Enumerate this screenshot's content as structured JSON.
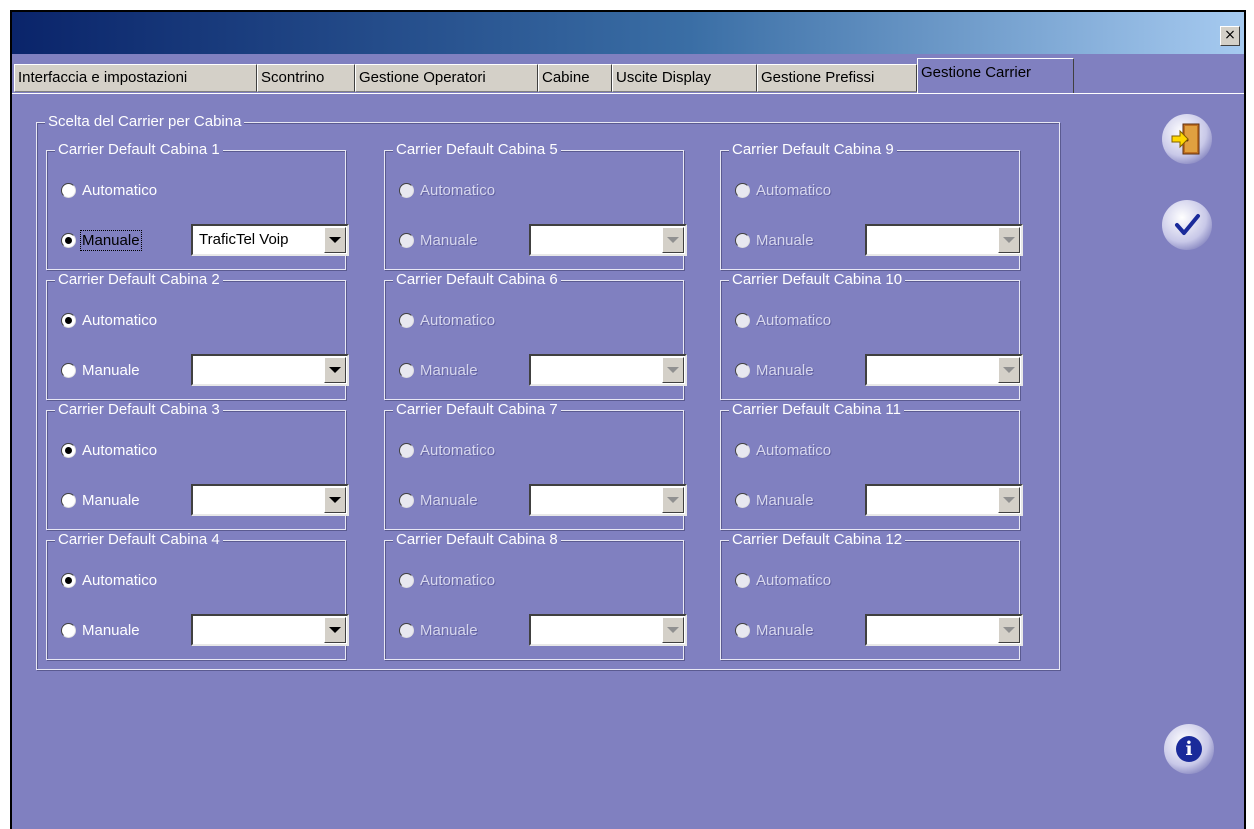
{
  "window": {
    "close_label": "×"
  },
  "tabs": [
    {
      "label": "Interfaccia  e impostazioni"
    },
    {
      "label": "Scontrino"
    },
    {
      "label": "Gestione Operatori"
    },
    {
      "label": "Cabine"
    },
    {
      "label": "Uscite Display"
    },
    {
      "label": "Gestione Prefissi"
    },
    {
      "label": "Gestione Carrier"
    }
  ],
  "active_tab": "Gestione Carrier",
  "main_group": {
    "title": "Scelta del Carrier per Cabina"
  },
  "option_labels": {
    "auto": "Automatico",
    "manual": "Manuale"
  },
  "cabins": [
    {
      "title": "Carrier Default Cabina 1",
      "selected": "manual",
      "carrier": "TraficTel Voip",
      "enabled": true
    },
    {
      "title": "Carrier Default Cabina 2",
      "selected": "auto",
      "carrier": "",
      "enabled": true
    },
    {
      "title": "Carrier Default Cabina 3",
      "selected": "auto",
      "carrier": "",
      "enabled": true
    },
    {
      "title": "Carrier Default Cabina 4",
      "selected": "auto",
      "carrier": "",
      "enabled": true
    },
    {
      "title": "Carrier Default Cabina 5",
      "selected": "",
      "carrier": "",
      "enabled": false
    },
    {
      "title": "Carrier Default Cabina 6",
      "selected": "",
      "carrier": "",
      "enabled": false
    },
    {
      "title": "Carrier Default Cabina 7",
      "selected": "",
      "carrier": "",
      "enabled": false
    },
    {
      "title": "Carrier Default Cabina 8",
      "selected": "",
      "carrier": "",
      "enabled": false
    },
    {
      "title": "Carrier Default Cabina 9",
      "selected": "",
      "carrier": "",
      "enabled": false
    },
    {
      "title": "Carrier Default Cabina 10",
      "selected": "",
      "carrier": "",
      "enabled": false
    },
    {
      "title": "Carrier Default Cabina 11",
      "selected": "",
      "carrier": "",
      "enabled": false
    },
    {
      "title": "Carrier Default Cabina 12",
      "selected": "",
      "carrier": "",
      "enabled": false
    }
  ],
  "buttons": {
    "exit": "exit-door-icon",
    "confirm": "checkmark-icon",
    "info": "i"
  }
}
